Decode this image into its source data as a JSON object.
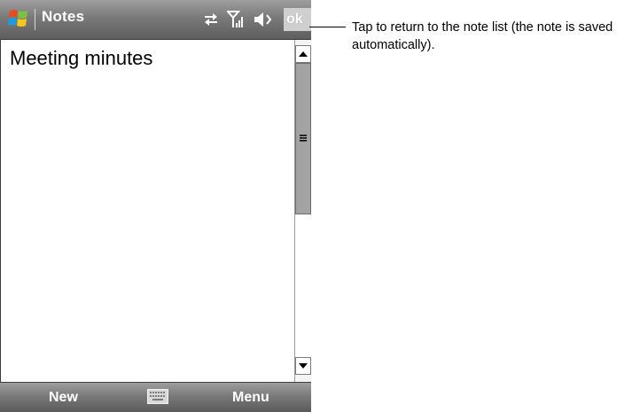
{
  "title_bar": {
    "app_title": "Notes",
    "ok_label": "ok"
  },
  "note": {
    "text": "Meeting minutes"
  },
  "menu_bar": {
    "left_softkey": "New",
    "right_softkey": "Menu"
  },
  "callout": {
    "text": "Tap to return to the note list (the note is saved automatically)."
  },
  "icons": {
    "start": "windows-flag-icon",
    "sync": "connectivity-arrows-icon",
    "signal": "signal-strength-icon",
    "volume": "speaker-icon",
    "keyboard": "keyboard-icon"
  }
}
